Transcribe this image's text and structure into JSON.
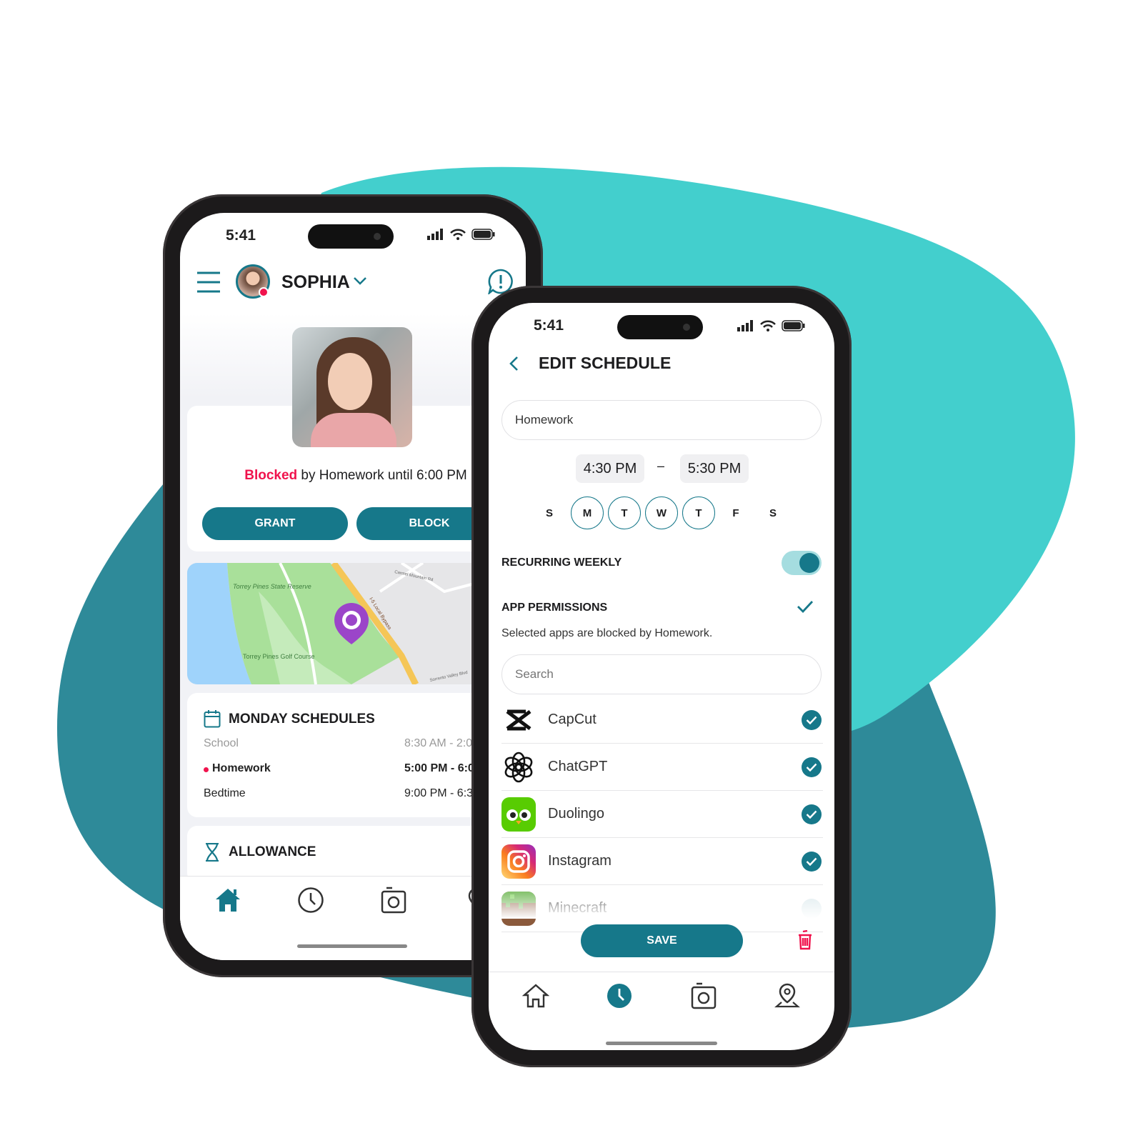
{
  "colors": {
    "accent": "#16788a",
    "blocked": "#f0134d",
    "bg_light": "#43cfcd",
    "bg_dark": "#2e8a99",
    "pin": "#9b45c9"
  },
  "phone_left": {
    "status": {
      "time": "5:41"
    },
    "header": {
      "child_name": "SOPHIA",
      "menu_icon": "hamburger-icon",
      "alert_icon": "alert-bubble-icon"
    },
    "status_line": {
      "blocked": "Blocked",
      "rest": " by Homework until 6:00 PM"
    },
    "buttons": {
      "grant": "GRANT",
      "block": "BLOCK"
    },
    "map": {
      "labels": [
        "Torrey Pines State Reserve",
        "Torrey Pines Golf Course",
        "I-5 Local Bypass",
        "Carmel Mountain Rd",
        "Sorrento Valley Blvd"
      ]
    },
    "schedules": {
      "title": "MONDAY SCHEDULES",
      "items": [
        {
          "name": "School",
          "time": "8:30 AM - 2:0",
          "active": false,
          "muted": true
        },
        {
          "name": "Homework",
          "time": "5:00 PM - 6:0",
          "active": true,
          "muted": false
        },
        {
          "name": "Bedtime",
          "time": "9:00 PM - 6:3",
          "active": false,
          "muted": false
        }
      ]
    },
    "allowance": {
      "title": "ALLOWANCE"
    },
    "nav": [
      "home-icon",
      "clock-icon",
      "camera-icon",
      "location-icon"
    ]
  },
  "phone_right": {
    "status": {
      "time": "5:41"
    },
    "title": "EDIT SCHEDULE",
    "name_value": "Homework",
    "start_time": "4:30 PM",
    "dash": "–",
    "end_time": "5:30 PM",
    "days": [
      {
        "label": "S",
        "selected": false
      },
      {
        "label": "M",
        "selected": true
      },
      {
        "label": "T",
        "selected": true
      },
      {
        "label": "W",
        "selected": true
      },
      {
        "label": "T",
        "selected": true
      },
      {
        "label": "F",
        "selected": false
      },
      {
        "label": "S",
        "selected": false
      }
    ],
    "recurring": {
      "label": "RECURRING WEEKLY",
      "on": true
    },
    "permissions": {
      "label": "APP PERMISSIONS",
      "subtitle": "Selected apps are blocked by Homework."
    },
    "search_placeholder": "Search",
    "apps": [
      {
        "name": "CapCut",
        "checked": true
      },
      {
        "name": "ChatGPT",
        "checked": true
      },
      {
        "name": "Duolingo",
        "checked": true
      },
      {
        "name": "Instagram",
        "checked": true
      },
      {
        "name": "Minecraft",
        "checked": false
      }
    ],
    "save": "SAVE",
    "nav": [
      "home-icon",
      "clock-icon",
      "camera-icon",
      "location-icon"
    ],
    "nav_active": "clock-icon"
  }
}
